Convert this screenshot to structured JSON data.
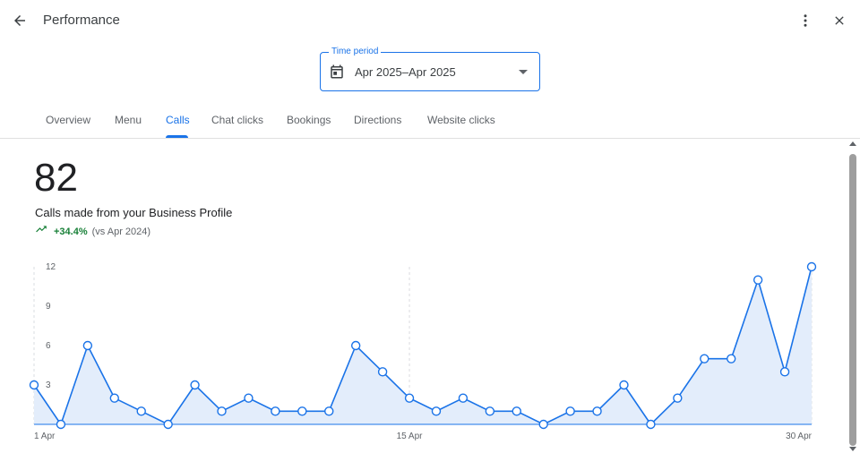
{
  "header": {
    "title": "Performance",
    "back_icon": "arrow-back-icon",
    "more_icon": "more-vert-icon",
    "close_icon": "close-icon"
  },
  "time_period": {
    "label": "Time period",
    "value": "Apr 2025–Apr 2025",
    "icon": "calendar-icon"
  },
  "tabs": [
    {
      "label": "Overview",
      "active": false
    },
    {
      "label": "Menu",
      "active": false
    },
    {
      "label": "Calls",
      "active": true
    },
    {
      "label": "Chat clicks",
      "active": false
    },
    {
      "label": "Bookings",
      "active": false
    },
    {
      "label": "Directions",
      "active": false
    },
    {
      "label": "Website clicks",
      "active": false
    }
  ],
  "summary": {
    "total": "82",
    "description": "Calls made from your Business Profile",
    "change": "+34.4%",
    "comparison": "(vs Apr 2024)",
    "trend_icon": "trending-up-icon"
  },
  "colors": {
    "accent": "#1a73e8",
    "positive": "#188038",
    "area_fill": "#e3edfb"
  },
  "chart_data": {
    "type": "area",
    "x": [
      1,
      2,
      3,
      4,
      5,
      6,
      7,
      8,
      9,
      10,
      11,
      12,
      13,
      14,
      15,
      16,
      17,
      18,
      19,
      20,
      21,
      22,
      23,
      24,
      25,
      26,
      27,
      28,
      29,
      30
    ],
    "x_unit": "Apr",
    "series": [
      {
        "values": [
          3,
          0,
          6,
          2,
          1,
          0,
          3,
          1,
          2,
          1,
          1,
          1,
          6,
          4,
          2,
          1,
          2,
          1,
          1,
          0,
          1,
          1,
          3,
          0,
          2,
          5,
          5,
          11,
          4,
          12
        ]
      }
    ],
    "ylim": [
      0,
      12
    ],
    "y_ticks": [
      "12",
      "9",
      "6",
      "3"
    ],
    "y_tick_values": [
      12,
      9,
      6,
      3
    ],
    "x_tick_labels": [
      "1 Apr",
      "15 Apr",
      "30 Apr"
    ],
    "x_tick_values": [
      1,
      15,
      30
    ],
    "grid": "vertical-dashed"
  }
}
